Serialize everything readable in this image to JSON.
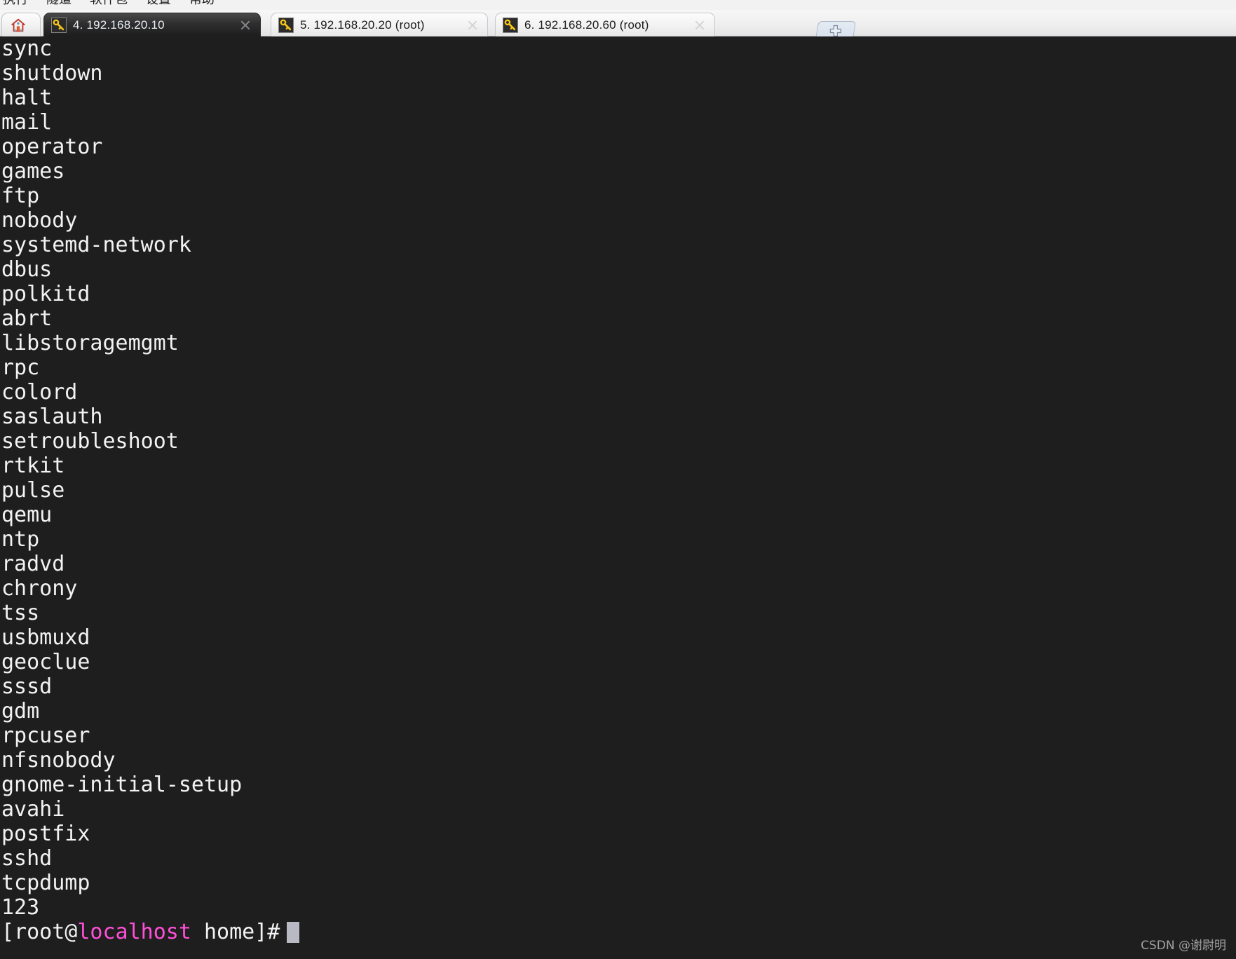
{
  "menubar": {
    "items": [
      {
        "label": "执行"
      },
      {
        "label": "隧道"
      },
      {
        "label": "软件包"
      },
      {
        "label": "设置"
      },
      {
        "label": "帮助"
      }
    ]
  },
  "tabstrip": {
    "home_tab": {
      "icon": "home-icon",
      "label": ""
    },
    "new_tab_button": {
      "icon": "plus-icon",
      "label": ""
    },
    "tabs": [
      {
        "icon": "key-icon",
        "label": "4. 192.168.20.10",
        "state": "active",
        "close_icon": "close-icon"
      },
      {
        "icon": "key-icon",
        "label": "5. 192.168.20.20 (root)",
        "state": "inactive",
        "close_icon": "close-icon"
      },
      {
        "icon": "key-icon",
        "label": "6. 192.168.20.60 (root)",
        "state": "inactive",
        "close_icon": "close-icon"
      }
    ]
  },
  "terminal": {
    "background_color": "#1e1e1e",
    "foreground_color": "#f2f2f2",
    "host_color": "#ff4fd8",
    "cursor_color": "#b9b9c4",
    "lines": [
      "sync",
      "shutdown",
      "halt",
      "mail",
      "operator",
      "games",
      "ftp",
      "nobody",
      "systemd-network",
      "dbus",
      "polkitd",
      "abrt",
      "libstoragemgmt",
      "rpc",
      "colord",
      "saslauth",
      "setroubleshoot",
      "rtkit",
      "pulse",
      "qemu",
      "ntp",
      "radvd",
      "chrony",
      "tss",
      "usbmuxd",
      "geoclue",
      "sssd",
      "gdm",
      "rpcuser",
      "nfsnobody",
      "gnome-initial-setup",
      "avahi",
      "postfix",
      "sshd",
      "tcpdump",
      "123"
    ],
    "prompt": {
      "prefix": "[root@",
      "host": "localhost",
      "suffix": " home]#",
      "cursor": "block"
    }
  },
  "watermark": {
    "text": "CSDN @谢尉明"
  }
}
